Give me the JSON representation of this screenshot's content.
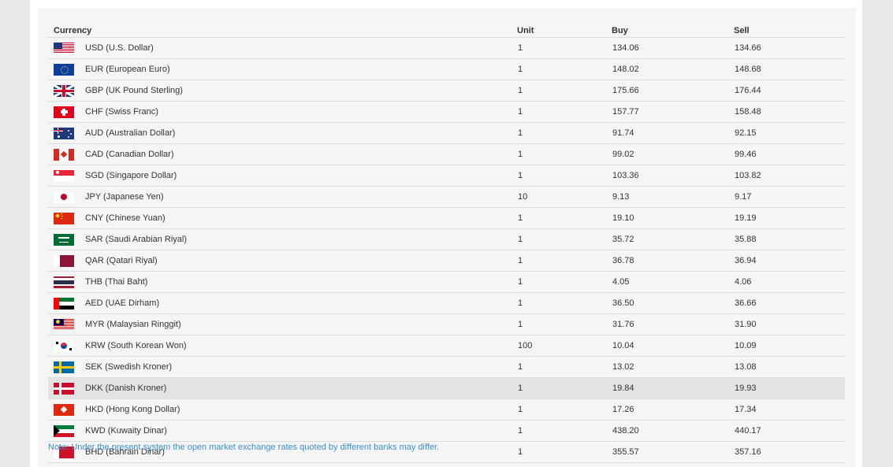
{
  "table": {
    "headers": {
      "currency": "Currency",
      "unit": "Unit",
      "buy": "Buy",
      "sell": "Sell"
    },
    "rows": [
      {
        "flag": "us-flag-icon",
        "currency": "USD (U.S. Dollar)",
        "unit": "1",
        "buy": "134.06",
        "sell": "134.66"
      },
      {
        "flag": "eu-flag-icon",
        "currency": "EUR (European Euro)",
        "unit": "1",
        "buy": "148.02",
        "sell": "148.68"
      },
      {
        "flag": "uk-flag-icon",
        "currency": "GBP (UK Pound Sterling)",
        "unit": "1",
        "buy": "175.66",
        "sell": "176.44"
      },
      {
        "flag": "switzerland-flag-icon",
        "currency": "CHF (Swiss Franc)",
        "unit": "1",
        "buy": "157.77",
        "sell": "158.48"
      },
      {
        "flag": "australia-flag-icon",
        "currency": "AUD (Australian Dollar)",
        "unit": "1",
        "buy": "91.74",
        "sell": "92.15"
      },
      {
        "flag": "canada-flag-icon",
        "currency": "CAD (Canadian Dollar)",
        "unit": "1",
        "buy": "99.02",
        "sell": "99.46"
      },
      {
        "flag": "singapore-flag-icon",
        "currency": "SGD (Singapore Dollar)",
        "unit": "1",
        "buy": "103.36",
        "sell": "103.82"
      },
      {
        "flag": "japan-flag-icon",
        "currency": "JPY (Japanese Yen)",
        "unit": "10",
        "buy": "9.13",
        "sell": "9.17"
      },
      {
        "flag": "china-flag-icon",
        "currency": "CNY (Chinese Yuan)",
        "unit": "1",
        "buy": "19.10",
        "sell": "19.19"
      },
      {
        "flag": "saudi-arabia-flag-icon",
        "currency": "SAR (Saudi Arabian Riyal)",
        "unit": "1",
        "buy": "35.72",
        "sell": "35.88"
      },
      {
        "flag": "qatar-flag-icon",
        "currency": "QAR (Qatari Riyal)",
        "unit": "1",
        "buy": "36.78",
        "sell": "36.94"
      },
      {
        "flag": "thailand-flag-icon",
        "currency": "THB (Thai Baht)",
        "unit": "1",
        "buy": "4.05",
        "sell": "4.06"
      },
      {
        "flag": "uae-flag-icon",
        "currency": "AED (UAE Dirham)",
        "unit": "1",
        "buy": "36.50",
        "sell": "36.66"
      },
      {
        "flag": "malaysia-flag-icon",
        "currency": "MYR (Malaysian Ringgit)",
        "unit": "1",
        "buy": "31.76",
        "sell": "31.90"
      },
      {
        "flag": "south-korea-flag-icon",
        "currency": "KRW (South Korean Won)",
        "unit": "100",
        "buy": "10.04",
        "sell": "10.09"
      },
      {
        "flag": "sweden-flag-icon",
        "currency": "SEK (Swedish Kroner)",
        "unit": "1",
        "buy": "13.02",
        "sell": "13.08"
      },
      {
        "flag": "denmark-flag-icon",
        "currency": "DKK (Danish Kroner)",
        "unit": "1",
        "buy": "19.84",
        "sell": "19.93",
        "highlighted": true
      },
      {
        "flag": "hong-kong-flag-icon",
        "currency": "HKD (Hong Kong Dollar)",
        "unit": "1",
        "buy": "17.26",
        "sell": "17.34"
      },
      {
        "flag": "kuwait-flag-icon",
        "currency": "KWD (Kuwaity Dinar)",
        "unit": "1",
        "buy": "438.20",
        "sell": "440.17"
      },
      {
        "flag": "bahrain-flag-icon",
        "currency": "BHD (Bahrain Dinar)",
        "unit": "1",
        "buy": "355.57",
        "sell": "357.16"
      }
    ]
  },
  "note": "Note: Under the present system the open market exchange rates quoted by different banks may differ.",
  "colors": {
    "note": "#3a8fcf",
    "highlight_row": "#e3e3e3",
    "panel": "#f5f5f5"
  }
}
